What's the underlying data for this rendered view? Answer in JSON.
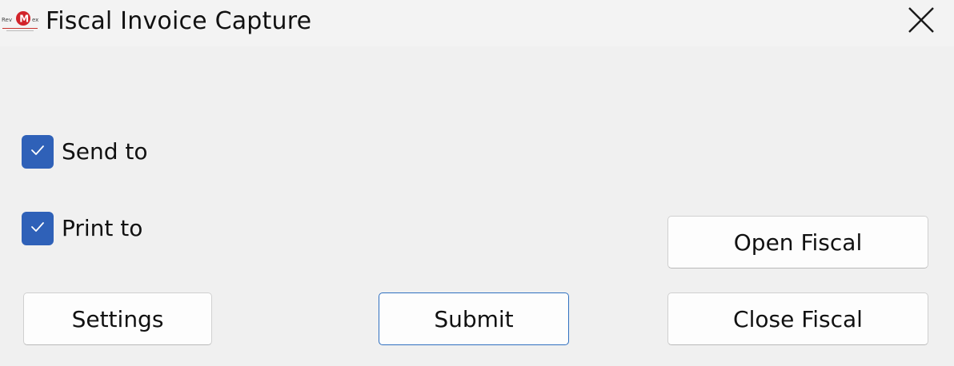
{
  "window": {
    "title": "Fiscal Invoice Capture",
    "logo_text_left": "Rev",
    "logo_text_right": "ex",
    "logo_letter": "M",
    "brand_color": "#d2232a"
  },
  "options": {
    "send_to": {
      "label": "Send to",
      "checked": true
    },
    "print_to": {
      "label": "Print to",
      "checked": true
    }
  },
  "buttons": {
    "settings": "Settings",
    "submit": "Submit",
    "open_fiscal": "Open Fiscal",
    "close_fiscal": "Close Fiscal"
  },
  "colors": {
    "checkbox_accent": "#2f61b8",
    "primary_border": "#2f6fc0"
  },
  "icons": {
    "close": "close-icon",
    "check": "checkmark-icon",
    "logo": "app-logo"
  }
}
